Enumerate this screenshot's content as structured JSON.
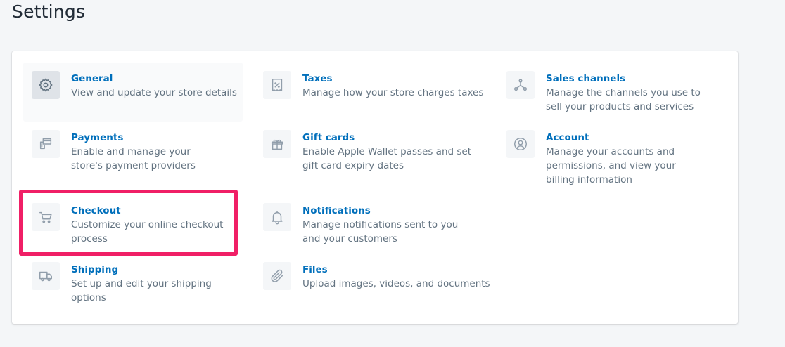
{
  "page": {
    "title": "Settings"
  },
  "items": [
    {
      "id": "general",
      "title": "General",
      "description": "View and update your store details",
      "icon": "gear-icon"
    },
    {
      "id": "taxes",
      "title": "Taxes",
      "description": "Manage how your store charges taxes",
      "icon": "receipt-percent-icon"
    },
    {
      "id": "sales-channels",
      "title": "Sales channels",
      "description": "Manage the channels you use to sell your products and services",
      "icon": "channels-icon"
    },
    {
      "id": "payments",
      "title": "Payments",
      "description": "Enable and manage your store's payment providers",
      "icon": "payments-icon"
    },
    {
      "id": "gift-cards",
      "title": "Gift cards",
      "description": "Enable Apple Wallet passes and set gift card expiry dates",
      "icon": "gift-icon"
    },
    {
      "id": "account",
      "title": "Account",
      "description": "Manage your accounts and permissions, and view your billing information",
      "icon": "profile-icon"
    },
    {
      "id": "checkout",
      "title": "Checkout",
      "description": "Customize your online checkout process",
      "icon": "cart-icon"
    },
    {
      "id": "notifications",
      "title": "Notifications",
      "description": "Manage notifications sent to you and your customers",
      "icon": "bell-icon"
    },
    {
      "id": "shipping",
      "title": "Shipping",
      "description": "Set up and edit your shipping options",
      "icon": "truck-icon"
    },
    {
      "id": "files",
      "title": "Files",
      "description": "Upload images, videos, and documents",
      "icon": "paperclip-icon"
    }
  ],
  "colors": {
    "accent": "#006fbb",
    "highlight": "#f01f66",
    "muted": "#637381"
  }
}
